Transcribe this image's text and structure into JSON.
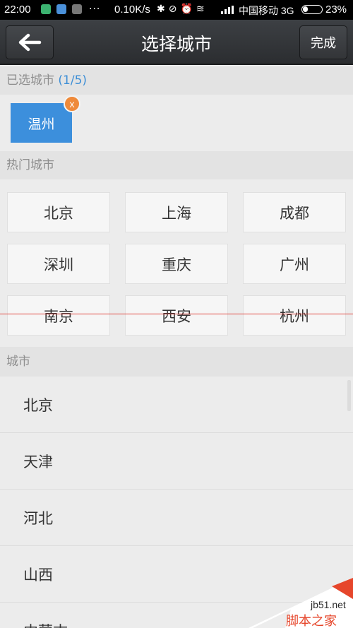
{
  "status_bar": {
    "time": "22:00",
    "dots": "...",
    "speed": "0.10K/s",
    "carrier": "中国移动 3G",
    "battery": "23%"
  },
  "header": {
    "back_icon": "arrow-left-icon",
    "title": "选择城市",
    "done_label": "完成"
  },
  "selected": {
    "label": "已选城市",
    "count": "(1/5)",
    "chips": [
      "温州"
    ],
    "remove_glyph": "x"
  },
  "hot": {
    "label": "热门城市",
    "cities": [
      "北京",
      "上海",
      "成都",
      "深圳",
      "重庆",
      "广州",
      "南京",
      "西安",
      "杭州"
    ]
  },
  "cities": {
    "label": "城市",
    "items": [
      "北京",
      "天津",
      "河北",
      "山西",
      "内蒙古"
    ]
  },
  "watermark": {
    "url": "jb51.net",
    "text": "脚本之家"
  }
}
